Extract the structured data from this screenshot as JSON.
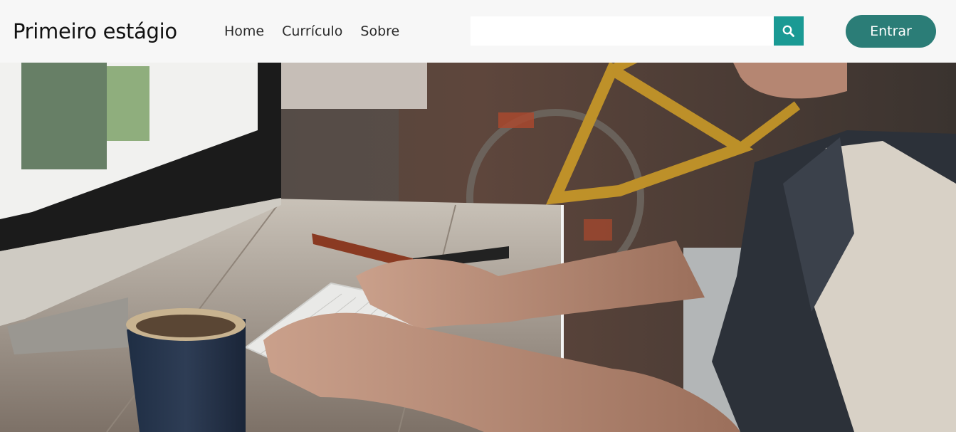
{
  "header": {
    "brand": "Primeiro estágio",
    "nav": [
      {
        "label": "Home"
      },
      {
        "label": "Currículo"
      },
      {
        "label": "Sobre"
      }
    ],
    "search": {
      "value": "",
      "placeholder": "",
      "icon": "search-icon"
    },
    "login_label": "Entrar"
  },
  "hero": {
    "image_description_icon": "workspace-photo"
  },
  "colors": {
    "navbar_bg": "#f7f7f7",
    "accent": "#1a9a94",
    "button": "#2b7d77"
  }
}
